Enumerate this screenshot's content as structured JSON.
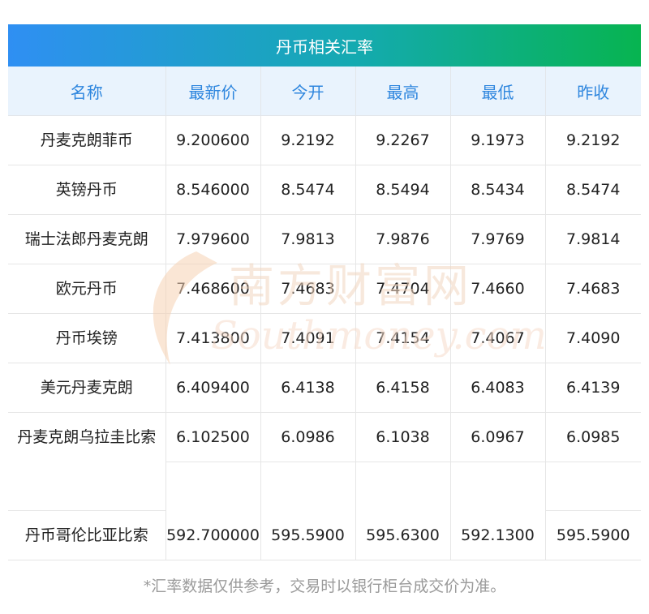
{
  "title": "丹币相关汇率",
  "columns": [
    "名称",
    "最新价",
    "今开",
    "最高",
    "最低",
    "昨收"
  ],
  "rows": [
    {
      "name": "丹麦克朗菲币",
      "latest": "9.200600",
      "open": "9.2192",
      "high": "9.2267",
      "low": "9.1973",
      "prev_close": "9.2192"
    },
    {
      "name": "英镑丹币",
      "latest": "8.546000",
      "open": "8.5474",
      "high": "8.5494",
      "low": "8.5434",
      "prev_close": "8.5474"
    },
    {
      "name": "瑞士法郎丹麦克朗",
      "latest": "7.979600",
      "open": "7.9813",
      "high": "7.9876",
      "low": "7.9769",
      "prev_close": "7.9814"
    },
    {
      "name": "欧元丹币",
      "latest": "7.468600",
      "open": "7.4683",
      "high": "7.4704",
      "low": "7.4660",
      "prev_close": "7.4683"
    },
    {
      "name": "丹币埃镑",
      "latest": "7.413800",
      "open": "7.4091",
      "high": "7.4154",
      "low": "7.4067",
      "prev_close": "7.4090"
    },
    {
      "name": "美元丹麦克朗",
      "latest": "6.409400",
      "open": "6.4138",
      "high": "6.4158",
      "low": "6.4083",
      "prev_close": "6.4139"
    },
    {
      "name": "丹麦克朗乌拉圭比索",
      "latest": "6.102500",
      "open": "6.0986",
      "high": "6.1038",
      "low": "6.0967",
      "prev_close": "6.0985"
    },
    {
      "name": "丹币哥伦比亚比索",
      "latest": "592.700000",
      "open": "595.5900",
      "high": "595.6300",
      "low": "592.1300",
      "prev_close": "595.5900"
    }
  ],
  "watermark": {
    "cn": "南方财富网",
    "en": "Southmoney.com",
    "color": "#f6d2b4"
  },
  "footnote": "*汇率数据仅供参考，交易时以银行柜台成交价为准。",
  "colors": {
    "header_text": "#2e86de",
    "header_bg": "#e9f3fd",
    "title_gradient_start": "#2f8ff3",
    "title_gradient_end": "#07b450"
  }
}
